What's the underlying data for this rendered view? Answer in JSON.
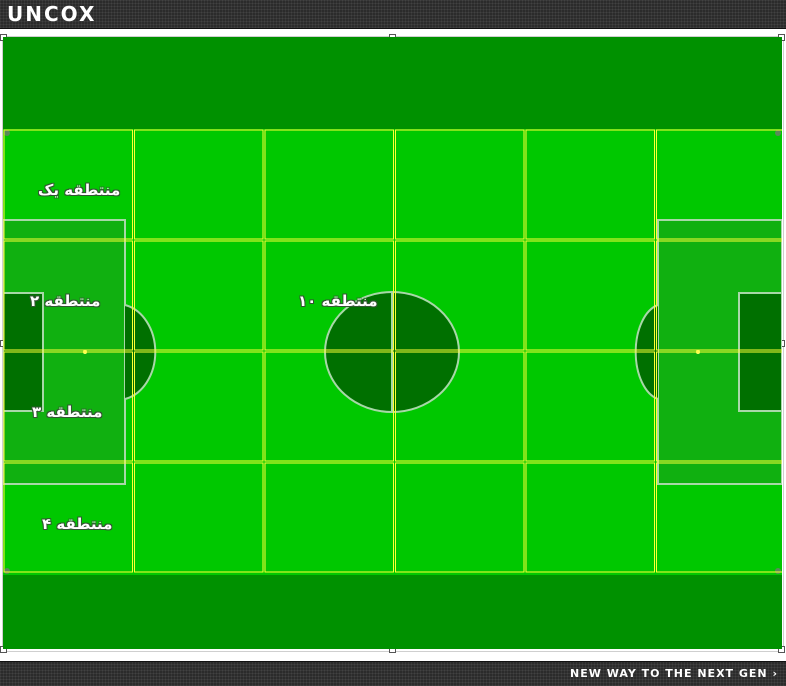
{
  "header": {
    "logo_text": "UNCOX"
  },
  "field": {
    "colors": {
      "outer": "#009100",
      "pitch": "#00c800",
      "zone_border": "#ffff33",
      "dark_area": "#007000",
      "penalty_area": "#10b010",
      "line": "#a8d8a8"
    },
    "grid": {
      "columns": 6,
      "rows": 4
    },
    "zones": [
      {
        "label": "منتطقه یک"
      },
      {
        "label": "منتطقه ۲"
      },
      {
        "label": "منتطقه ۳"
      },
      {
        "label": "منتطقه ۴"
      },
      {
        "label": "منتطقه ۱۰"
      }
    ]
  },
  "footer": {
    "tagline": "NEW WAY TO THE NEXT GEN ›"
  }
}
